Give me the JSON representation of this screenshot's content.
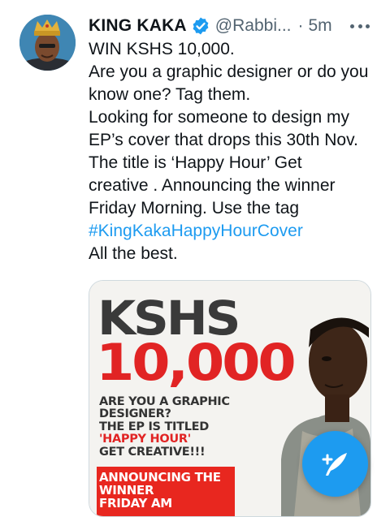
{
  "tweet": {
    "author_name": "KING KAKA",
    "handle": "@Rabbi...",
    "separator": "·",
    "time": "5m",
    "text_lines": [
      "WIN KSHS 10,000.",
      "Are you a graphic designer or do you",
      "know one? Tag them.",
      "Looking for someone to design my",
      "EP’s cover that drops this 30th Nov.",
      "The title is ‘Happy Hour’ Get",
      "creative . Announcing the winner",
      "Friday Morning. Use the tag"
    ],
    "hashtag": "#KingKakaHappyHourCover",
    "closing": "All the best.",
    "icons": {
      "verified": "verified-badge-icon",
      "more": "more-options-icon"
    }
  },
  "media": {
    "poster_lines": {
      "kshs": "KSHS",
      "amount": "10,000",
      "q1": "ARE YOU A GRAPHIC",
      "q2": "DESIGNER?",
      "q3": "THE EP IS TITLED",
      "q4": "'HAPPY HOUR'",
      "q5": "GET CREATIVE!!!",
      "b1": "ANNOUNCING THE",
      "b2": "WINNER",
      "b3": "FRIDAY AM"
    }
  },
  "fab": {
    "icon": "compose-tweet-icon"
  },
  "colors": {
    "accent": "#1d9bf0",
    "poster_red": "#e12424",
    "secondary_text": "#536471"
  }
}
